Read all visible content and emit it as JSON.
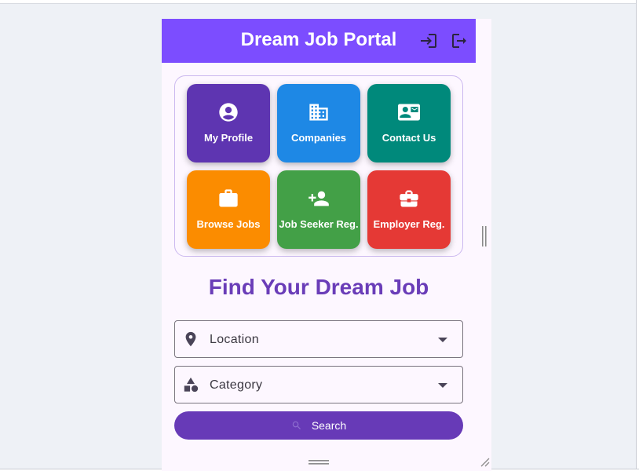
{
  "appbar": {
    "title": "Dream Job Portal",
    "login_icon": "login-icon",
    "logout_icon": "logout-icon",
    "color": "#7c4dff"
  },
  "tiles": [
    {
      "label": "My Profile",
      "icon": "account-circle-icon",
      "color": "#5e35b1"
    },
    {
      "label": "Companies",
      "icon": "business-icon",
      "color": "#1e88e5"
    },
    {
      "label": "Contact Us",
      "icon": "contact-mail-icon",
      "color": "#00897b"
    },
    {
      "label": "Browse Jobs",
      "icon": "work-icon",
      "color": "#fb8c00"
    },
    {
      "label": "Job Seeker Reg.",
      "icon": "person-add-icon",
      "color": "#43a047"
    },
    {
      "label": "Employer Reg.",
      "icon": "business-center-icon",
      "color": "#e53935"
    }
  ],
  "heading": "Find Your Dream Job",
  "filters": {
    "location": {
      "label": "Location",
      "icon": "location-pin-icon"
    },
    "category": {
      "label": "Category",
      "icon": "category-icon"
    }
  },
  "search": {
    "label": "Search",
    "color": "#673ab7"
  }
}
